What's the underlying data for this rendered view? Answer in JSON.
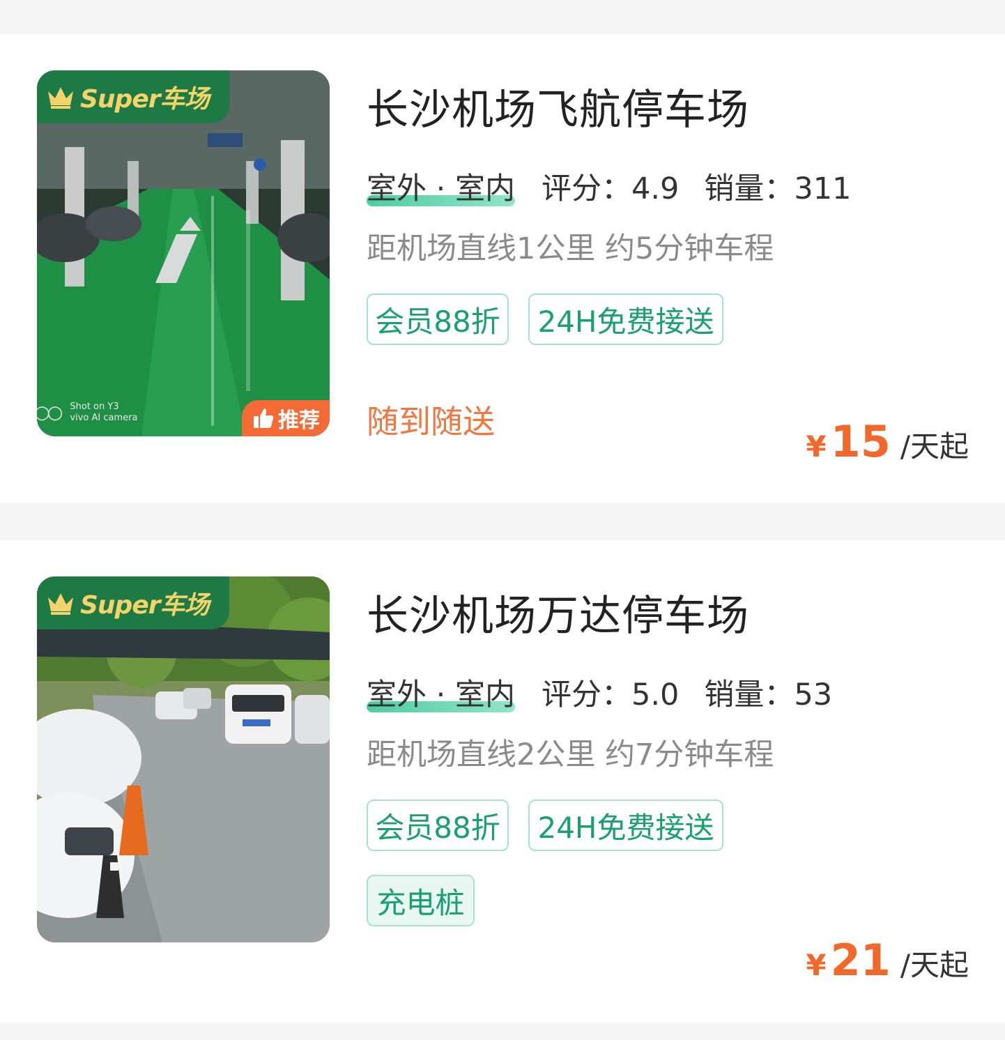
{
  "listings": [
    {
      "badge_text": "Super车场",
      "recommend_label": "推荐",
      "watermark": [
        "Shot on Y3",
        "vivo AI camera"
      ],
      "name": "长沙机场飞航停车场",
      "location_type": "室外 · 室内",
      "rating_label": "评分：",
      "rating": "4.9",
      "sales_label": "销量：",
      "sales": "311",
      "distance": "距机场直线1公里 约5分钟车程",
      "tags": [
        "会员88折",
        "24H免费接送"
      ],
      "service_note": "随到随送",
      "currency": "¥",
      "price": "15",
      "price_unit": "/天起"
    },
    {
      "badge_text": "Super车场",
      "name": "长沙机场万达停车场",
      "location_type": "室外 · 室内",
      "rating_label": "评分：",
      "rating": "5.0",
      "sales_label": "销量：",
      "sales": "53",
      "distance": "距机场直线2公里 约7分钟车程",
      "tags": [
        "会员88折",
        "24H免费接送",
        "充电桩"
      ],
      "currency": "¥",
      "price": "21",
      "price_unit": "/天起"
    }
  ],
  "colors": {
    "accent_green": "#19a06f",
    "price_orange": "#f2682a",
    "badge_green": "#1e7a45",
    "badge_gold": "#f3d36a"
  }
}
